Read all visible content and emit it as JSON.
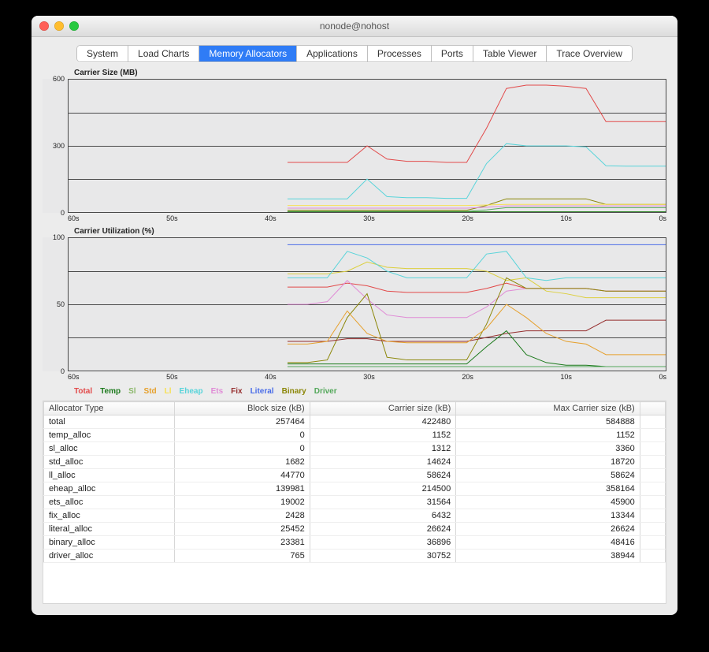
{
  "window": {
    "title": "nonode@nohost"
  },
  "tabs": [
    {
      "label": "System",
      "active": false
    },
    {
      "label": "Load Charts",
      "active": false
    },
    {
      "label": "Memory Allocators",
      "active": true
    },
    {
      "label": "Applications",
      "active": false
    },
    {
      "label": "Processes",
      "active": false
    },
    {
      "label": "Ports",
      "active": false
    },
    {
      "label": "Table Viewer",
      "active": false
    },
    {
      "label": "Trace Overview",
      "active": false
    }
  ],
  "chart_data": [
    {
      "type": "line",
      "title": "Carrier Size (MB)",
      "ylim": [
        0,
        600
      ],
      "yticks": [
        0,
        300,
        600
      ],
      "grid_y": [
        0,
        150,
        300,
        450,
        600
      ],
      "xticks": [
        "60s",
        "50s",
        "40s",
        "30s",
        "20s",
        "10s",
        "0s"
      ],
      "x": [
        38,
        36,
        34,
        32,
        30,
        28,
        26,
        24,
        22,
        20,
        18,
        16,
        14,
        12,
        10,
        8,
        6,
        4,
        2,
        0
      ],
      "series": {
        "Total": {
          "color": "#e24a4a",
          "values": [
            225,
            225,
            225,
            225,
            300,
            240,
            230,
            230,
            225,
            225,
            380,
            560,
            575,
            575,
            570,
            560,
            410,
            410,
            410,
            410
          ]
        },
        "Eheap": {
          "color": "#58d4da",
          "values": [
            60,
            60,
            60,
            60,
            150,
            70,
            65,
            65,
            62,
            62,
            220,
            310,
            300,
            300,
            300,
            295,
            210,
            208,
            208,
            208
          ]
        },
        "Binary": {
          "color": "#8b8607",
          "values": [
            8,
            8,
            8,
            8,
            8,
            8,
            8,
            8,
            8,
            8,
            30,
            60,
            60,
            60,
            60,
            60,
            35,
            35,
            35,
            35
          ]
        },
        "Ll": {
          "color": "#f7e055",
          "values": [
            30,
            30,
            30,
            30,
            30,
            30,
            30,
            30,
            30,
            30,
            32,
            35,
            35,
            35,
            35,
            35,
            35,
            35,
            35,
            35
          ]
        },
        "Ets": {
          "color": "#e08bd6",
          "values": [
            18,
            18,
            18,
            18,
            18,
            18,
            18,
            18,
            18,
            18,
            22,
            28,
            28,
            28,
            28,
            28,
            28,
            28,
            28,
            28
          ]
        },
        "Driver": {
          "color": "#53a85a",
          "values": [
            3,
            3,
            3,
            3,
            3,
            3,
            3,
            3,
            3,
            3,
            10,
            20,
            20,
            20,
            20,
            20,
            20,
            20,
            20,
            20
          ]
        },
        "Sl": {
          "color": "#8cb86b",
          "values": [
            2,
            2,
            2,
            2,
            2,
            2,
            2,
            2,
            2,
            2,
            2,
            2,
            2,
            2,
            2,
            2,
            2,
            2,
            2,
            2
          ]
        },
        "Temp": {
          "color": "#1c7a1c",
          "values": [
            1,
            1,
            1,
            1,
            1,
            1,
            1,
            1,
            1,
            1,
            1,
            1,
            1,
            1,
            1,
            1,
            1,
            1,
            1,
            1
          ]
        }
      }
    },
    {
      "type": "line",
      "title": "Carrier Utilization (%)",
      "ylim": [
        0,
        100
      ],
      "yticks": [
        0,
        50,
        100
      ],
      "grid_y": [
        0,
        25,
        50,
        75,
        100
      ],
      "xticks": [
        "60s",
        "50s",
        "40s",
        "30s",
        "20s",
        "10s",
        "0s"
      ],
      "x": [
        38,
        36,
        34,
        32,
        30,
        28,
        26,
        24,
        22,
        20,
        18,
        16,
        14,
        12,
        10,
        8,
        6,
        4,
        2,
        0
      ],
      "series": {
        "Literal": {
          "color": "#4a6de8",
          "values": [
            95,
            95,
            95,
            95,
            95,
            95,
            95,
            95,
            95,
            95,
            95,
            95,
            95,
            95,
            95,
            95,
            95,
            95,
            95,
            95
          ]
        },
        "Ll": {
          "color": "#dccf3e",
          "values": [
            73,
            73,
            73,
            75,
            82,
            78,
            77,
            77,
            77,
            77,
            75,
            68,
            70,
            60,
            58,
            55,
            55,
            55,
            55,
            55
          ]
        },
        "Eheap": {
          "color": "#58d4da",
          "values": [
            70,
            70,
            70,
            90,
            85,
            75,
            70,
            70,
            70,
            70,
            88,
            90,
            70,
            68,
            70,
            70,
            70,
            70,
            70,
            70
          ]
        },
        "Total": {
          "color": "#e24a4a",
          "values": [
            63,
            63,
            63,
            66,
            64,
            60,
            59,
            59,
            59,
            59,
            62,
            66,
            62,
            62,
            62,
            62,
            60,
            60,
            60,
            60
          ]
        },
        "Ets": {
          "color": "#e08bd6",
          "values": [
            50,
            50,
            52,
            68,
            54,
            42,
            40,
            40,
            40,
            40,
            48,
            60,
            62,
            62,
            62,
            62,
            60,
            60,
            60,
            60
          ]
        },
        "Binary": {
          "color": "#8b8607",
          "values": [
            6,
            6,
            8,
            40,
            58,
            10,
            8,
            8,
            8,
            8,
            35,
            70,
            62,
            62,
            62,
            62,
            60,
            60,
            60,
            60
          ]
        },
        "Fix": {
          "color": "#952d2d",
          "values": [
            22,
            22,
            22,
            24,
            24,
            22,
            22,
            22,
            22,
            22,
            25,
            28,
            30,
            30,
            30,
            30,
            38,
            38,
            38,
            38
          ]
        },
        "Std": {
          "color": "#e6a02c",
          "values": [
            20,
            20,
            22,
            45,
            28,
            22,
            21,
            21,
            21,
            21,
            32,
            50,
            40,
            28,
            22,
            20,
            12,
            12,
            12,
            12
          ]
        },
        "Temp": {
          "color": "#1c7a1c",
          "values": [
            5,
            5,
            5,
            5,
            5,
            5,
            5,
            5,
            5,
            5,
            18,
            30,
            12,
            6,
            4,
            4,
            3,
            3,
            3,
            3
          ]
        },
        "Driver": {
          "color": "#53a85a",
          "values": [
            3,
            3,
            3,
            3,
            3,
            3,
            3,
            3,
            3,
            3,
            3,
            3,
            3,
            3,
            3,
            3,
            3,
            3,
            3,
            3
          ]
        }
      }
    }
  ],
  "legend": [
    {
      "label": "Total",
      "color": "#e24a4a"
    },
    {
      "label": "Temp",
      "color": "#1c7a1c"
    },
    {
      "label": "Sl",
      "color": "#8cb86b"
    },
    {
      "label": "Std",
      "color": "#e6a02c"
    },
    {
      "label": "Ll",
      "color": "#f7e055"
    },
    {
      "label": "Eheap",
      "color": "#58d4da"
    },
    {
      "label": "Ets",
      "color": "#e08bd6"
    },
    {
      "label": "Fix",
      "color": "#952d2d"
    },
    {
      "label": "Literal",
      "color": "#4a6de8"
    },
    {
      "label": "Binary",
      "color": "#8b8607"
    },
    {
      "label": "Driver",
      "color": "#53a85a"
    }
  ],
  "table": {
    "columns": [
      "Allocator Type",
      "Block size (kB)",
      "Carrier size (kB)",
      "Max Carrier size (kB)"
    ],
    "rows": [
      [
        "total",
        257464,
        422480,
        584888
      ],
      [
        "temp_alloc",
        0,
        1152,
        1152
      ],
      [
        "sl_alloc",
        0,
        1312,
        3360
      ],
      [
        "std_alloc",
        1682,
        14624,
        18720
      ],
      [
        "ll_alloc",
        44770,
        58624,
        58624
      ],
      [
        "eheap_alloc",
        139981,
        214500,
        358164
      ],
      [
        "ets_alloc",
        19002,
        31564,
        45900
      ],
      [
        "fix_alloc",
        2428,
        6432,
        13344
      ],
      [
        "literal_alloc",
        25452,
        26624,
        26624
      ],
      [
        "binary_alloc",
        23381,
        36896,
        48416
      ],
      [
        "driver_alloc",
        765,
        30752,
        38944
      ]
    ]
  }
}
